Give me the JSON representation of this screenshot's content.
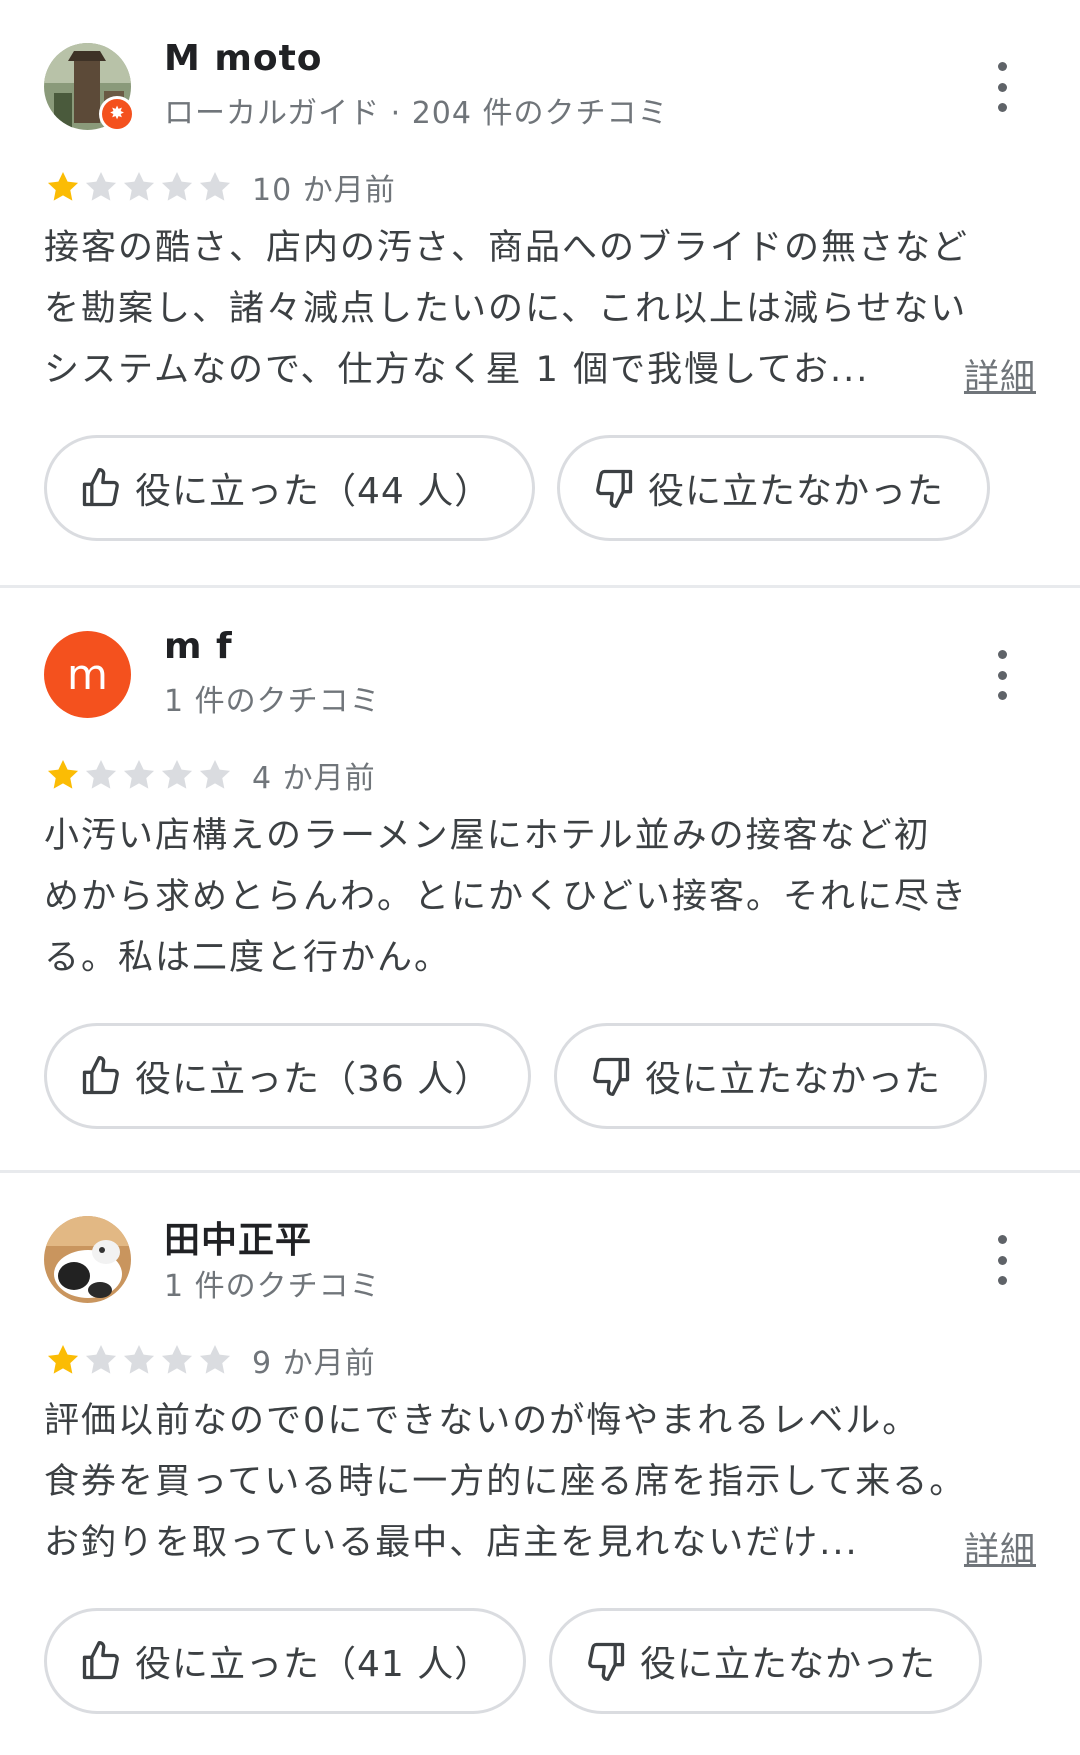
{
  "reviews": [
    {
      "name": "M moto",
      "meta": "ローカルガイド · 204 件のクチコミ",
      "stars": 1,
      "max_stars": 5,
      "time": "10 か月前",
      "lines": [
        "接客の酷さ、店内の汚さ、商品へのブライドの無さなど",
        "を勘案し、諸々減点したいのに、これ以上は減らせない",
        "システムなので、仕方なく星 1 個で我慢してお..."
      ],
      "more": "詳細",
      "helpful": "役に立った（44 人）",
      "not_helpful": "役に立たなかった"
    },
    {
      "name": "m f",
      "avatar_letter": "m",
      "meta": "1 件のクチコミ",
      "stars": 1,
      "max_stars": 5,
      "time": "4 か月前",
      "lines": [
        "小汚い店構えのラーメン屋にホテル並みの接客など初",
        "めから求めとらんわ。とにかくひどい接客。それに尽き",
        "る。私は二度と行かん。"
      ],
      "helpful": "役に立った（36 人）",
      "not_helpful": "役に立たなかった"
    },
    {
      "name": "田中正平",
      "meta": "1 件のクチコミ",
      "stars": 1,
      "max_stars": 5,
      "time": "9 か月前",
      "lines": [
        "評価以前なので0にできないのが悔やまれるレベル。",
        "食券を買っている時に一方的に座る席を指示して来る。",
        "お釣りを取っている最中、店主を見れないだけ..."
      ],
      "more": "詳細",
      "helpful": "役に立った（41 人）",
      "not_helpful": "役に立たなかった"
    }
  ],
  "colors": {
    "star_filled": "#fbbc04",
    "star_empty": "#dadce0",
    "avatar_orange": "#f4511e",
    "divider": "#e8eaed"
  },
  "icons": {
    "thumb_up": "thumb-up-icon",
    "thumb_down": "thumb-down-icon",
    "more": "more-vert-icon",
    "star": "star-icon",
    "local_guide_badge": "local-guide-badge-icon"
  }
}
